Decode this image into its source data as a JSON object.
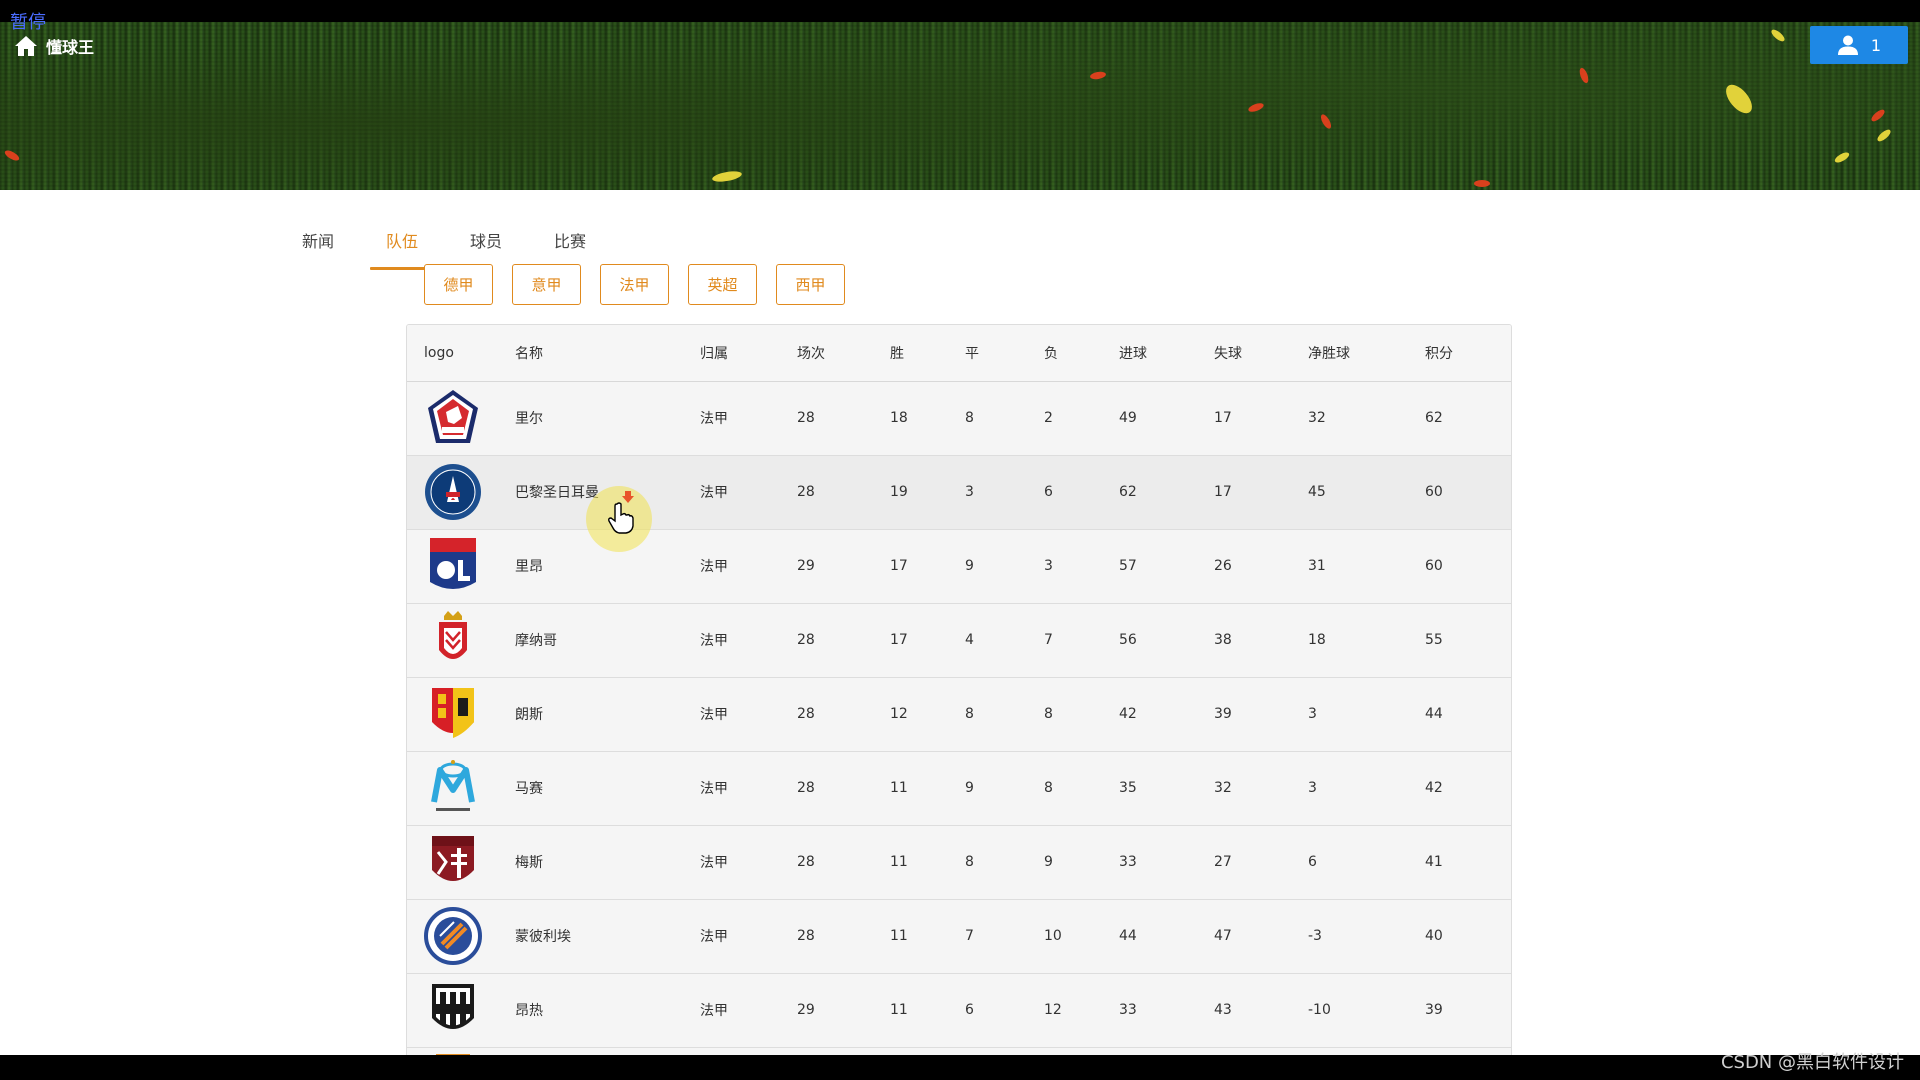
{
  "overlay": {
    "pause": "暂停",
    "watermark": "CSDN @黑白软件设计"
  },
  "header": {
    "app_title": "懂球王",
    "user_count": "1"
  },
  "tabs": [
    {
      "label": "新闻",
      "active": false
    },
    {
      "label": "队伍",
      "active": true
    },
    {
      "label": "球员",
      "active": false
    },
    {
      "label": "比赛",
      "active": false
    }
  ],
  "leagues": [
    "德甲",
    "意甲",
    "法甲",
    "英超",
    "西甲"
  ],
  "table": {
    "headers": [
      "logo",
      "名称",
      "归属",
      "场次",
      "胜",
      "平",
      "负",
      "进球",
      "失球",
      "净胜球",
      "积分"
    ],
    "rows": [
      {
        "logo": "lille-logo",
        "name": "里尔",
        "league": "法甲",
        "played": "28",
        "win": "18",
        "draw": "8",
        "loss": "2",
        "gf": "49",
        "ga": "17",
        "gd": "32",
        "pts": "62"
      },
      {
        "logo": "psg-logo",
        "name": "巴黎圣日耳曼",
        "league": "法甲",
        "played": "28",
        "win": "19",
        "draw": "3",
        "loss": "6",
        "gf": "62",
        "ga": "17",
        "gd": "45",
        "pts": "60"
      },
      {
        "logo": "lyon-logo",
        "name": "里昂",
        "league": "法甲",
        "played": "29",
        "win": "17",
        "draw": "9",
        "loss": "3",
        "gf": "57",
        "ga": "26",
        "gd": "31",
        "pts": "60"
      },
      {
        "logo": "monaco-logo",
        "name": "摩纳哥",
        "league": "法甲",
        "played": "28",
        "win": "17",
        "draw": "4",
        "loss": "7",
        "gf": "56",
        "ga": "38",
        "gd": "18",
        "pts": "55"
      },
      {
        "logo": "lens-logo",
        "name": "朗斯",
        "league": "法甲",
        "played": "28",
        "win": "12",
        "draw": "8",
        "loss": "8",
        "gf": "42",
        "ga": "39",
        "gd": "3",
        "pts": "44"
      },
      {
        "logo": "marseille-logo",
        "name": "马赛",
        "league": "法甲",
        "played": "28",
        "win": "11",
        "draw": "9",
        "loss": "8",
        "gf": "35",
        "ga": "32",
        "gd": "3",
        "pts": "42"
      },
      {
        "logo": "metz-logo",
        "name": "梅斯",
        "league": "法甲",
        "played": "28",
        "win": "11",
        "draw": "8",
        "loss": "9",
        "gf": "33",
        "ga": "27",
        "gd": "6",
        "pts": "41"
      },
      {
        "logo": "montpellier-logo",
        "name": "蒙彼利埃",
        "league": "法甲",
        "played": "28",
        "win": "11",
        "draw": "7",
        "loss": "10",
        "gf": "44",
        "ga": "47",
        "gd": "-3",
        "pts": "40"
      },
      {
        "logo": "angers-logo",
        "name": "昂热",
        "league": "法甲",
        "played": "29",
        "win": "11",
        "draw": "6",
        "loss": "12",
        "gf": "33",
        "ga": "43",
        "gd": "-10",
        "pts": "39"
      }
    ]
  }
}
